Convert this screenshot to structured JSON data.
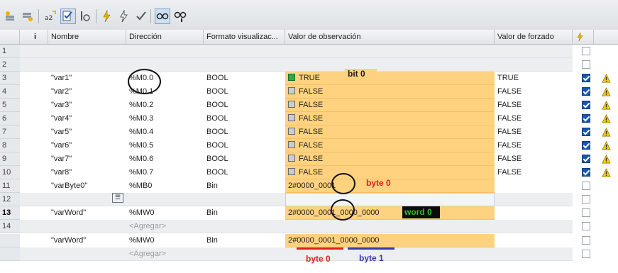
{
  "toolbar": {
    "icons": [
      "insert-row-icon",
      "add-row-icon",
      "rename-icon",
      "monitor-all-icon",
      "monitor-once-icon",
      "modify-now-icon",
      "modify-trigger-icon",
      "force-icon",
      "show-hide-columns-icon",
      "show-all-modify-columns-icon"
    ]
  },
  "columns": {
    "info": "i",
    "name": "Nombre",
    "address": "Dirección",
    "format": "Formato visualizac...",
    "monitor": "Valor de observación",
    "force": "Valor de forzado"
  },
  "rows": [
    {
      "num": "1",
      "name": "",
      "address": "",
      "format": "",
      "monitor": "",
      "force": ""
    },
    {
      "num": "2",
      "name": "",
      "address": "",
      "format": "",
      "monitor": "",
      "force": ""
    },
    {
      "num": "3",
      "name": "\"var1\"",
      "address": "%M0.0",
      "format": "BOOL",
      "monitor": "TRUE",
      "force": "TRUE"
    },
    {
      "num": "4",
      "name": "\"var2\"",
      "address": "%M0.1",
      "format": "BOOL",
      "monitor": "FALSE",
      "force": "FALSE"
    },
    {
      "num": "5",
      "name": "\"var3\"",
      "address": "%M0.2",
      "format": "BOOL",
      "monitor": "FALSE",
      "force": "FALSE"
    },
    {
      "num": "6",
      "name": "\"var4\"",
      "address": "%M0.3",
      "format": "BOOL",
      "monitor": "FALSE",
      "force": "FALSE"
    },
    {
      "num": "7",
      "name": "\"var5\"",
      "address": "%M0.4",
      "format": "BOOL",
      "monitor": "FALSE",
      "force": "FALSE"
    },
    {
      "num": "8",
      "name": "\"var6\"",
      "address": "%M0.5",
      "format": "BOOL",
      "monitor": "FALSE",
      "force": "FALSE"
    },
    {
      "num": "9",
      "name": "\"var7\"",
      "address": "%M0.6",
      "format": "BOOL",
      "monitor": "FALSE",
      "force": "FALSE"
    },
    {
      "num": "10",
      "name": "\"var8\"",
      "address": "%M0.7",
      "format": "BOOL",
      "monitor": "FALSE",
      "force": "FALSE"
    },
    {
      "num": "11",
      "name": "\"varByte0\"",
      "address": "%MB0",
      "format": "Bin",
      "monitor": "2#0000_0001",
      "force": ""
    },
    {
      "num": "12",
      "name": "",
      "address": "",
      "format": "",
      "monitor": "",
      "force": ""
    },
    {
      "num": "13",
      "name": "\"varWord\"",
      "address": "%MW0",
      "format": "Bin",
      "monitor": "2#0000_0001_0000_0000",
      "force": ""
    },
    {
      "num": "14",
      "name": "",
      "address": "<Agregar>",
      "format": "",
      "monitor": "",
      "force": ""
    },
    {
      "num": "",
      "name": "\"varWord\"",
      "address": "%MW0",
      "format": "Bin",
      "monitor": "2#0000_0001_0000_0000",
      "force": ""
    },
    {
      "num": "",
      "name": "",
      "address": "<Agregar>",
      "format": "",
      "monitor": "",
      "force": ""
    }
  ],
  "annotations": {
    "bit0": "bit 0",
    "byte0_row": "byte 0",
    "word0": "word 0",
    "byte0_bottom": "byte 0",
    "byte1_bottom": "byte 1"
  },
  "colors": {
    "monitor_fill": "#ffd27f",
    "annotation_red": "#e02020",
    "annotation_blue": "#3a3aa8",
    "word_label": "#30c030"
  }
}
